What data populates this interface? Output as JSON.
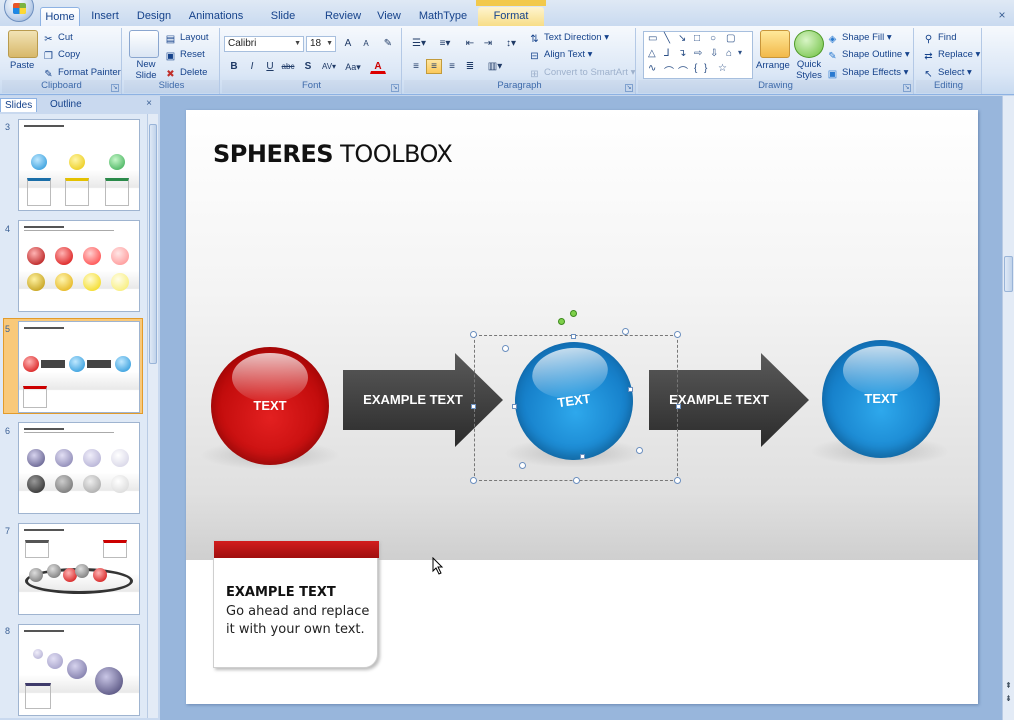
{
  "tabs": [
    "Home",
    "Insert",
    "Design",
    "Animations",
    "Slide Show",
    "Review",
    "View",
    "MathType",
    "Format"
  ],
  "ribbon": {
    "clipboard": {
      "label": "Clipboard",
      "paste": "Paste",
      "cut": "Cut",
      "copy": "Copy",
      "format_painter": "Format Painter"
    },
    "slides": {
      "label": "Slides",
      "new_slide": "New Slide",
      "layout": "Layout",
      "reset": "Reset",
      "delete": "Delete"
    },
    "font": {
      "label": "Font",
      "family": "Calibri",
      "size": "18"
    },
    "paragraph": {
      "label": "Paragraph",
      "text_direction": "Text Direction",
      "align_text": "Align Text",
      "convert_smartart": "Convert to SmartArt"
    },
    "drawing": {
      "label": "Drawing",
      "arrange": "Arrange",
      "quick_styles": "Quick Styles",
      "shape_fill": "Shape Fill",
      "shape_outline": "Shape Outline",
      "shape_effects": "Shape Effects"
    },
    "editing": {
      "label": "Editing",
      "find": "Find",
      "replace": "Replace",
      "select": "Select"
    }
  },
  "panel": {
    "tab_slides": "Slides",
    "tab_outline": "Outline",
    "slide_numbers": [
      "3",
      "4",
      "5",
      "6",
      "7",
      "8"
    ]
  },
  "slide": {
    "title_bold": "SPHERES",
    "title_rest": "TOOLBOX",
    "sphere1": "TEXT",
    "arrow1": "EXAMPLE TEXT",
    "sphere2": "TEXT",
    "arrow2": "EXAMPLE TEXT",
    "sphere3": "TEXT",
    "callout_head": "EXAMPLE TEXT",
    "callout_body": "Go ahead and replace it with your own text."
  },
  "colors": {
    "ribbon_text": "#15428b",
    "red_sphere": "#d11818",
    "blue_sphere": "#1b8fd6",
    "arrow_gray": "#3a3a3a",
    "selected_thumb": "#f9c97a"
  }
}
